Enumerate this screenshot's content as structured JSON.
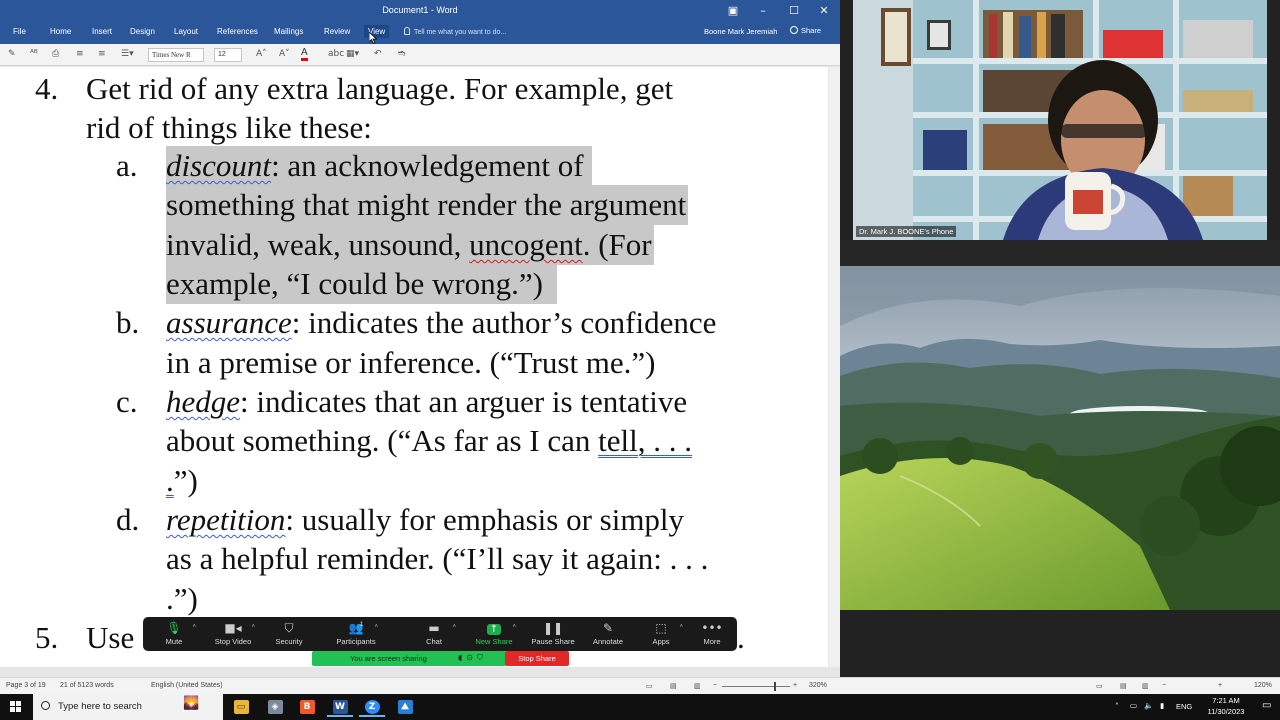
{
  "word": {
    "window_title": "Document1 - Word",
    "tabs": [
      "File",
      "Home",
      "Insert",
      "Design",
      "Layout",
      "References",
      "Mailings",
      "Review",
      "View"
    ],
    "active_tab": "View",
    "tell_me": "Tell me what you want to do...",
    "user": "Boone Mark Jeremiah",
    "share": "Share",
    "font_name": "Times New R",
    "font_size": "12",
    "status": {
      "page": "Page 3 of 19",
      "words": "21 of 5123 words",
      "language": "English (United States)",
      "zoom": "320%"
    }
  },
  "document": {
    "item4_num": "4.",
    "item4_l1": "Get rid of any extra language. For example, get",
    "item4_l2": "rid of things like these:",
    "a_label": "a.",
    "a_term": "discount",
    "a_l1_rest": ": an acknowledgement of",
    "a_l2": "something that might render the argument",
    "a_l3_pre": "invalid, weak, unsound, ",
    "a_l3_word": "uncogent",
    "a_l3_post": ".  (For",
    "a_l4": "example, “I could be wrong.”)",
    "b_label": "b.",
    "b_term": "assurance",
    "b_l1_rest": ": indicates the author’s confidence",
    "b_l2": "in a premise or inference. (“Trust me.”)",
    "c_label": "c.",
    "c_term": "hedge",
    "c_l1_rest": ": indicates that an arguer is tentative",
    "c_l2_pre": "about something. (“As far as I can ",
    "c_l2_tail": "tell, . . .",
    "c_l3_dot": ".",
    "c_l3_rest": "”)",
    "d_label": "d.",
    "d_term": "repetition",
    "d_l1_rest": ": usually for emphasis or simply",
    "d_l2": "as a helpful reminder. (“I’ll say it again: . . .",
    "d_l3": ".”)",
    "item5_num": "5.",
    "item5_l1": "Use",
    "item5_tail": "."
  },
  "zoom_toolbar": {
    "buttons": [
      {
        "label": "Mute",
        "icon": "microphone-icon"
      },
      {
        "label": "Stop Video",
        "icon": "video-camera-icon"
      },
      {
        "label": "Security",
        "icon": "shield-icon"
      },
      {
        "label": "Participants",
        "icon": "participants-icon",
        "count": "1"
      },
      {
        "label": "Chat",
        "icon": "chat-icon"
      },
      {
        "label": "New Share",
        "icon": "share-arrow-icon"
      },
      {
        "label": "Pause Share",
        "icon": "pause-icon"
      },
      {
        "label": "Annotate",
        "icon": "pencil-icon"
      },
      {
        "label": "Apps",
        "icon": "apps-icon"
      },
      {
        "label": "More",
        "icon": "more-dots-icon"
      }
    ],
    "sharing_status": "You are screen sharing",
    "stop_share": "Stop Share"
  },
  "video": {
    "participant_name": "Dr. Mark J. BOONE's Phone"
  },
  "taskbar": {
    "search_placeholder": "Type here to search",
    "language": "ENG",
    "time": "7:21 AM",
    "date": "11/30/2023"
  },
  "right_status": {
    "zoom": "120%"
  },
  "colors": {
    "word_blue": "#2b579a",
    "zoom_green": "#23c055",
    "stop_red": "#e02828"
  }
}
